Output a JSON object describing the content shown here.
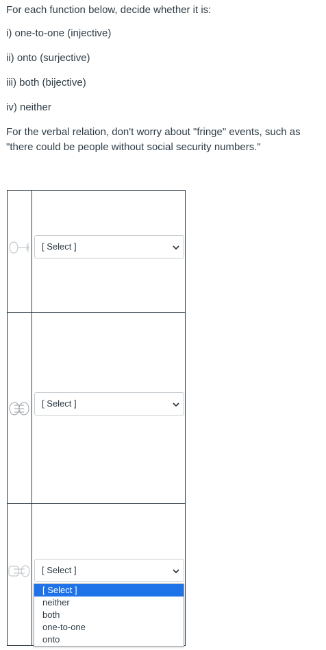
{
  "intro": {
    "line0": "For each function below, decide whether it is:",
    "line1": "i) one-to-one (injective)",
    "line2": "ii) onto (surjective)",
    "line3": "iii) both (bijective)",
    "line4": "iv) neither",
    "note": "For the verbal relation, don't worry about \"fringe\" events, such as \"there could be people without social security numbers.\""
  },
  "questions": [
    {
      "thumb_icon": "function-arrow-diagram-icon",
      "selected": "[ Select ]"
    },
    {
      "thumb_icon": "two-ovals-mapping-diagram-icon",
      "selected": "[ Select ]"
    },
    {
      "thumb_icon": "set-mapping-diagram-icon",
      "selected": "[ Select ]"
    }
  ],
  "dropdown": {
    "options": [
      "[ Select ]",
      "neither",
      "both",
      "one-to-one",
      "onto"
    ],
    "highlighted": "[ Select ]"
  },
  "colors": {
    "text": "#2d3b45",
    "border": "#2d3b45",
    "highlight": "#1e73e8",
    "select_border": "#c7cdd1"
  }
}
